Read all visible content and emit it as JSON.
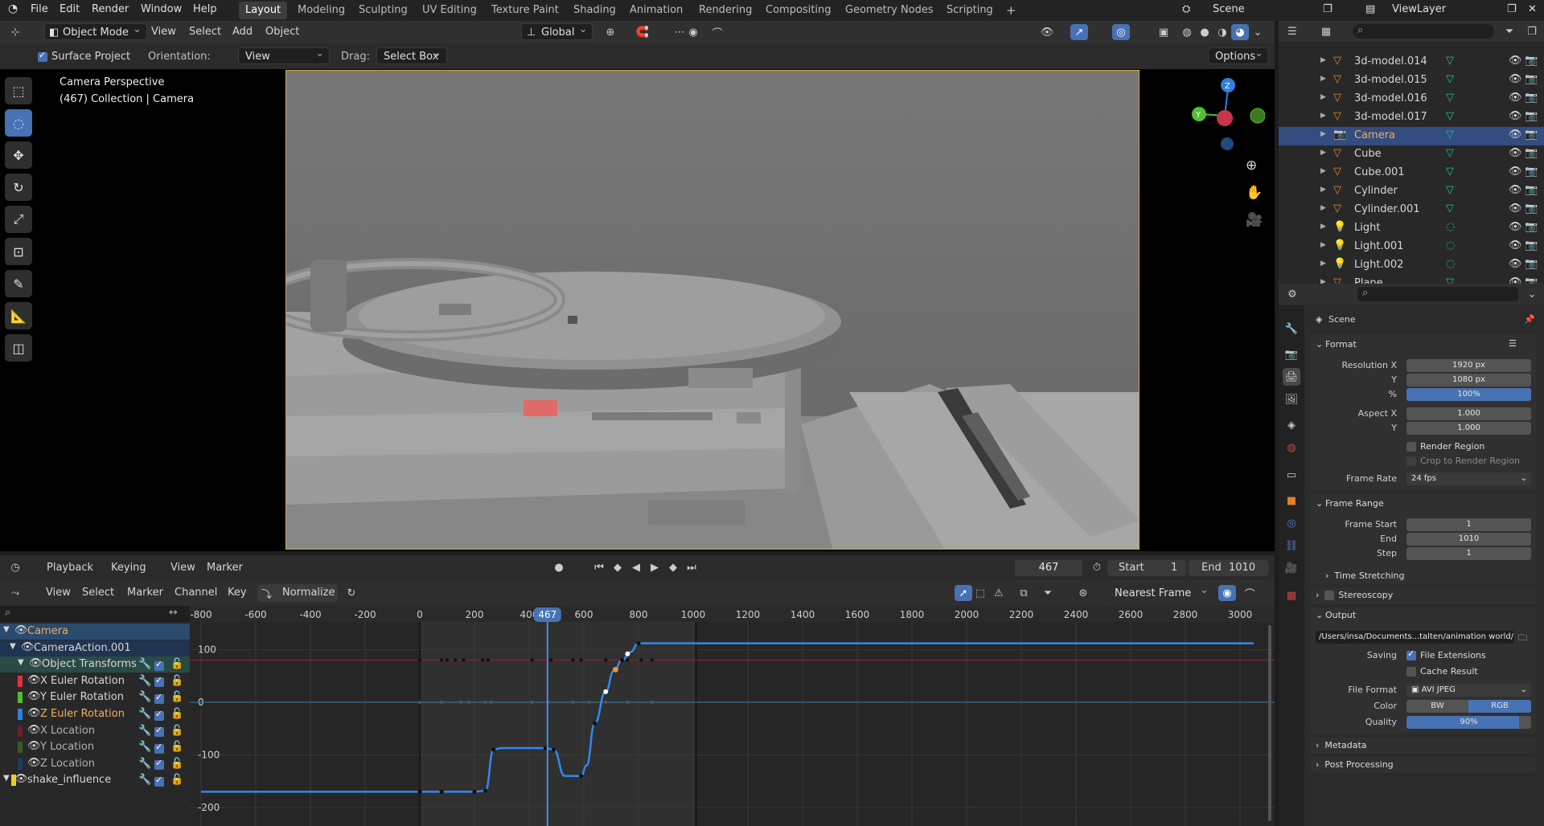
{
  "topbar": {
    "menus": [
      "File",
      "Edit",
      "Render",
      "Window",
      "Help"
    ],
    "workspaces": [
      "Layout",
      "Modeling",
      "Sculpting",
      "UV Editing",
      "Texture Paint",
      "Shading",
      "Animation",
      "Rendering",
      "Compositing",
      "Geometry Nodes",
      "Scripting"
    ],
    "active_workspace": "Layout",
    "add_tab": "+",
    "scene": "Scene",
    "view_layer": "ViewLayer"
  },
  "viewport_header": {
    "mode": "Object Mode",
    "menus": [
      "View",
      "Select",
      "Add",
      "Object"
    ],
    "transform_orientation": "Global"
  },
  "tool_settings": {
    "surface_project_label": "Surface Project",
    "surface_project_checked": true,
    "orientation_label": "Orientation:",
    "orientation_value": "View",
    "drag_label": "Drag:",
    "drag_value": "Select Box",
    "options_label": "Options"
  },
  "viewport": {
    "overlay_line1": "Camera Perspective",
    "overlay_line2": "(467) Collection | Camera",
    "gizmo_axes": [
      "Z",
      "Y"
    ]
  },
  "timeline": {
    "menus": [
      "Playback",
      "Keying",
      "View",
      "Marker"
    ],
    "current_frame": "467",
    "start_label": "Start",
    "start_value": "1",
    "end_label": "End",
    "end_value": "1010"
  },
  "graph_editor": {
    "menus": [
      "View",
      "Select",
      "Marker",
      "Channel",
      "Key"
    ],
    "normalize_label": "Normalize",
    "snap_mode": "Nearest Frame",
    "frame_ticks": [
      "-800",
      "-600",
      "-400",
      "-200",
      "0",
      "200",
      "400",
      "600",
      "800",
      "1000",
      "1200",
      "1400",
      "1600",
      "1800",
      "2000",
      "2200",
      "2400",
      "2600",
      "2800",
      "3000"
    ],
    "value_ticks": [
      "100",
      "0",
      "-100",
      "-200"
    ],
    "playhead_label": "467"
  },
  "channels": [
    {
      "label": "Camera",
      "level": 0,
      "color": "#f0b060"
    },
    {
      "label": "CameraAction.001",
      "level": 1,
      "color": "#d6d6d6"
    },
    {
      "label": "Object Transforms",
      "level": 2,
      "color": "#d6d6d6"
    },
    {
      "label": "X Euler Rotation",
      "level": 3,
      "color": "#d6d6d6",
      "swatch": "#e03040"
    },
    {
      "label": "Y Euler Rotation",
      "level": 3,
      "color": "#d6d6d6",
      "swatch": "#50c030"
    },
    {
      "label": "Z Euler Rotation",
      "level": 3,
      "color": "#f0b060",
      "swatch": "#2f80e0"
    },
    {
      "label": "X Location",
      "level": 3,
      "color": "#b0b0b0",
      "swatch": "#6a1f28"
    },
    {
      "label": "Y Location",
      "level": 3,
      "color": "#b0b0b0",
      "swatch": "#3a5a20"
    },
    {
      "label": "Z Location",
      "level": 3,
      "color": "#b0b0b0",
      "swatch": "#1f3a60"
    },
    {
      "label": "shake_influence",
      "level": 0,
      "color": "#d6d6d6",
      "swatch": "#e6d020"
    }
  ],
  "outliner": {
    "items": [
      {
        "name": "3d-model.014",
        "type": "mesh",
        "selected": false
      },
      {
        "name": "3d-model.015",
        "type": "mesh",
        "selected": false
      },
      {
        "name": "3d-model.016",
        "type": "mesh",
        "selected": false
      },
      {
        "name": "3d-model.017",
        "type": "mesh",
        "selected": false
      },
      {
        "name": "Camera",
        "type": "camera",
        "selected": true
      },
      {
        "name": "Cube",
        "type": "mesh",
        "selected": false
      },
      {
        "name": "Cube.001",
        "type": "mesh",
        "selected": false
      },
      {
        "name": "Cylinder",
        "type": "mesh",
        "selected": false
      },
      {
        "name": "Cylinder.001",
        "type": "mesh",
        "selected": false
      },
      {
        "name": "Light",
        "type": "light",
        "selected": false
      },
      {
        "name": "Light.001",
        "type": "light",
        "selected": false
      },
      {
        "name": "Light.002",
        "type": "light",
        "selected": false
      },
      {
        "name": "Plane",
        "type": "mesh",
        "selected": false
      }
    ]
  },
  "properties": {
    "context": "Scene",
    "format": {
      "title": "Format",
      "resolution_x_label": "Resolution X",
      "resolution_x": "1920 px",
      "resolution_y_label": "Y",
      "resolution_y": "1080 px",
      "percent_label": "%",
      "percent": "100%",
      "percent_fraction": 1.0,
      "aspect_x_label": "Aspect X",
      "aspect_x": "1.000",
      "aspect_y_label": "Y",
      "aspect_y": "1.000",
      "render_region": "Render Region",
      "crop_region": "Crop to Render Region",
      "frame_rate_label": "Frame Rate",
      "frame_rate": "24 fps"
    },
    "frame_range": {
      "title": "Frame Range",
      "start_label": "Frame Start",
      "start": "1",
      "end_label": "End",
      "end": "1010",
      "step_label": "Step",
      "step": "1",
      "time_stretching": "Time Stretching"
    },
    "stereoscopy": "Stereoscopy",
    "output": {
      "title": "Output",
      "path": "/Users/insa/Documents...talten/animation world/",
      "saving_label": "Saving",
      "file_extensions": "File Extensions",
      "cache_result": "Cache Result",
      "file_format_label": "File Format",
      "file_format": "AVI JPEG",
      "color_label": "Color",
      "color_bw": "BW",
      "color_rgb": "RGB",
      "quality_label": "Quality",
      "quality": "90%",
      "quality_fraction": 0.9
    },
    "metadata": "Metadata",
    "post_processing": "Post Processing"
  }
}
